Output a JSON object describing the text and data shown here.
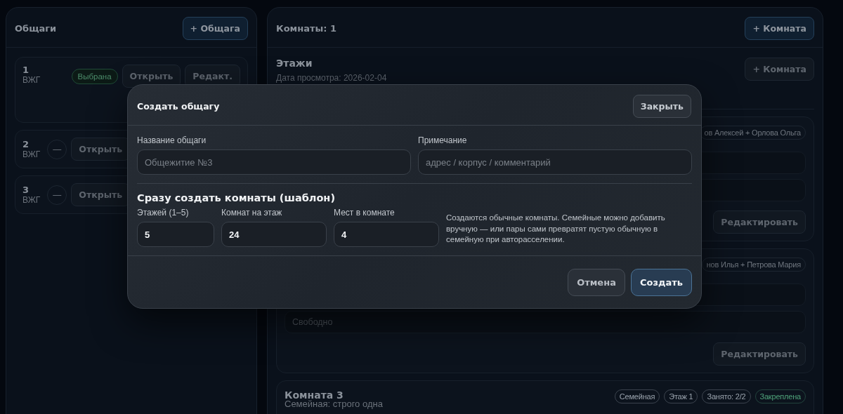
{
  "sidebar": {
    "title": "Общаги",
    "add_button": "+ Общага",
    "dorms": [
      {
        "number": "1",
        "name": "ВЖГ",
        "selected": true,
        "badge": "Выбрана",
        "actions": [
          "Открыть",
          "Редакт."
        ]
      },
      {
        "number": "2",
        "name": "ВЖГ",
        "selected": false,
        "badge": "—",
        "actions": [
          "Открыть"
        ]
      },
      {
        "number": "3",
        "name": "ВЖГ",
        "selected": false,
        "badge": "—",
        "actions": [
          "Открыть"
        ]
      }
    ]
  },
  "rooms_panel": {
    "title": "Комнаты: 1",
    "add_button": "+ Комната",
    "floors": {
      "title": "Этажи",
      "date": "Дата просмотра: 2026-02-04",
      "add_button": "+ Комната"
    },
    "rooms": [
      {
        "occupant_tag": "ов Алексей + Орлова Ольга",
        "slots": [
          {
            "kind": "blank"
          },
          {
            "kind": "blank"
          }
        ],
        "edit_button": "Редактировать"
      },
      {
        "occupant_tag": "нов Илья + Петрова Мария",
        "slots": [
          {
            "kind": "blank"
          },
          {
            "kind": "free",
            "text": "Свободно"
          }
        ],
        "edit_button": "Редактировать"
      },
      {
        "title": "Комната 3",
        "subtitle": "Семейная: строго одна",
        "tags": [
          {
            "text": "Семейная",
            "color": "#9aa3ad"
          },
          {
            "text": "Этаж 1",
            "color": "#9aa3ad"
          },
          {
            "text": "Занято: 2/2",
            "color": "#9aa3ad"
          },
          {
            "text": "Закреплена",
            "color": "#4fa37a"
          }
        ]
      }
    ]
  },
  "modal": {
    "title": "Создать общагу",
    "close_button": "Закрыть",
    "fields": [
      {
        "label": "Название общаги",
        "placeholder": "Общежитие №3"
      },
      {
        "label": "Примечание",
        "placeholder": "адрес / корпус / комментарий"
      }
    ],
    "template": {
      "title": "Сразу создать комнаты (шаблон)",
      "fields": [
        {
          "label": "Этажей (1–5)",
          "value": "5"
        },
        {
          "label": "Комнат на этаж",
          "value": "24"
        },
        {
          "label": "Мест в комнате",
          "value": "4"
        }
      ],
      "note": "Создаются обычные комнаты. Семейные можно добавить вручную — или пары сами превратят пустую обычную в семейную при авторасселении."
    },
    "buttons": [
      {
        "label": "Отмена",
        "primary": false
      },
      {
        "label": "Создать",
        "primary": true
      }
    ]
  }
}
